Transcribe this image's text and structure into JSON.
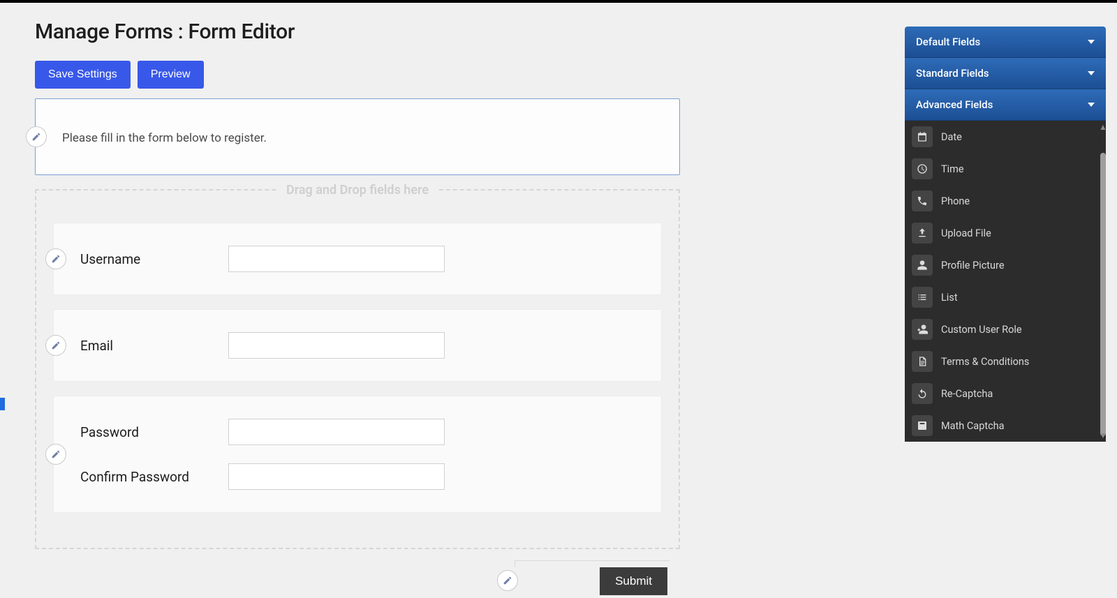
{
  "page": {
    "title": "Manage Forms : Form Editor"
  },
  "toolbar": {
    "save_label": "Save Settings",
    "preview_label": "Preview"
  },
  "header_block": {
    "message": "Please fill in the form below to register."
  },
  "dropzone": {
    "label": "Drag and Drop fields here"
  },
  "fields": [
    {
      "label": "Username",
      "value": ""
    },
    {
      "label": "Email",
      "value": ""
    },
    {
      "label": "Password",
      "value": "",
      "confirm_label": "Confirm Password",
      "confirm_value": ""
    }
  ],
  "submit": {
    "label": "Submit"
  },
  "sidebar": {
    "groups": [
      {
        "label": "Default Fields"
      },
      {
        "label": "Standard Fields"
      },
      {
        "label": "Advanced Fields"
      }
    ],
    "advanced_items": [
      {
        "label": "Date",
        "icon": "calendar"
      },
      {
        "label": "Time",
        "icon": "clock"
      },
      {
        "label": "Phone",
        "icon": "phone"
      },
      {
        "label": "Upload File",
        "icon": "upload"
      },
      {
        "label": "Profile Picture",
        "icon": "person"
      },
      {
        "label": "List",
        "icon": "list"
      },
      {
        "label": "Custom User Role",
        "icon": "userplus"
      },
      {
        "label": "Terms & Conditions",
        "icon": "doc"
      },
      {
        "label": "Re-Captcha",
        "icon": "refresh"
      },
      {
        "label": "Math Captcha",
        "icon": "math"
      }
    ]
  }
}
